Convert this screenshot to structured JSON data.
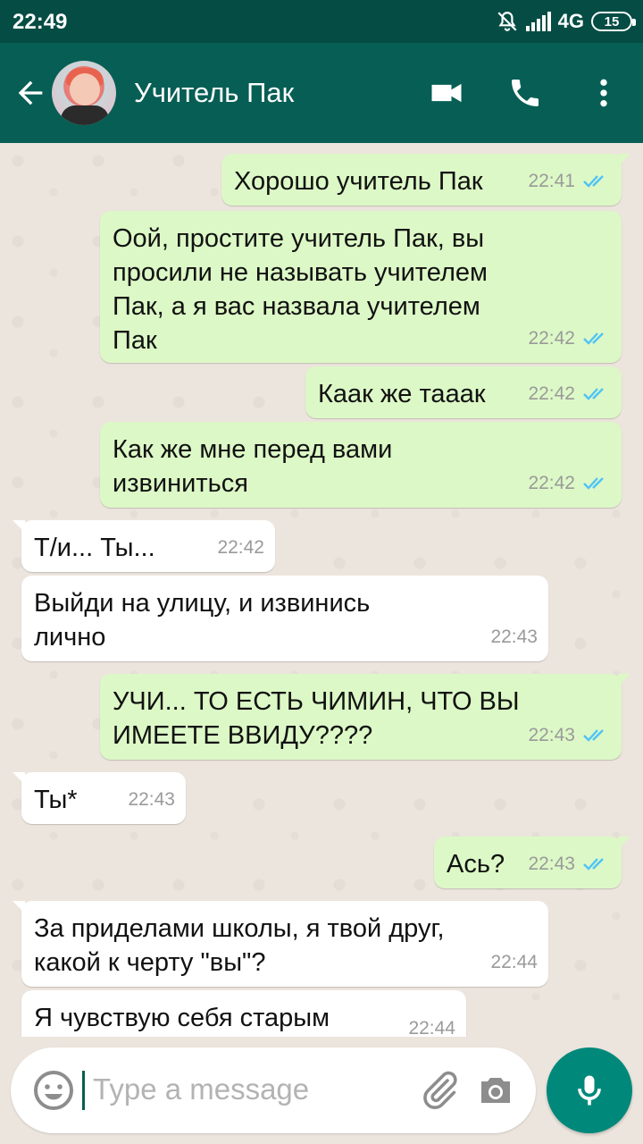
{
  "status_bar": {
    "time": "22:49",
    "network": "4G",
    "battery": "15"
  },
  "header": {
    "contact_name": "Учитель Пак"
  },
  "messages": [
    {
      "dir": "out",
      "text": "Хорошо учитель Пак",
      "time": "22:41",
      "read": true
    },
    {
      "dir": "out",
      "text": "Оой, простите учитель Пак, вы\nпросили не называть учителем\nПак, а я вас назвала учителем\nПак",
      "time": "22:42",
      "read": true
    },
    {
      "dir": "out",
      "text": "Кaак же тааак",
      "time": "22:42",
      "read": true
    },
    {
      "dir": "out",
      "text": "Как же мне перед вами\nизвиниться",
      "time": "22:42",
      "read": true
    },
    {
      "dir": "in",
      "text": "Т/и... Ты...",
      "time": "22:42"
    },
    {
      "dir": "in",
      "text": "Выйди на улицу, и извинись\nлично",
      "time": "22:43"
    },
    {
      "dir": "out",
      "text": "УЧИ... ТО ЕСТЬ ЧИМИН, ЧТО ВЫ\nИМЕЕТЕ ВВИДУ????",
      "time": "22:43",
      "read": true
    },
    {
      "dir": "in",
      "text": "Ты*",
      "time": "22:43"
    },
    {
      "dir": "out",
      "text": "Ась?",
      "time": "22:43",
      "read": true
    },
    {
      "dir": "in",
      "text": "За приделами школы, я твой друг,\nкакой к черту \"вы\"?",
      "time": "22:44"
    },
    {
      "dir": "in",
      "text": "Я чувствую себя старым",
      "time": "22:44"
    }
  ],
  "input": {
    "placeholder": "Type a message"
  },
  "colors": {
    "header": "#075e54",
    "status_bar": "#054d44",
    "outgoing_bubble": "#dcf8c6",
    "incoming_bubble": "#ffffff",
    "read_ticks": "#4fc3f7",
    "mic_button": "#00897b"
  }
}
